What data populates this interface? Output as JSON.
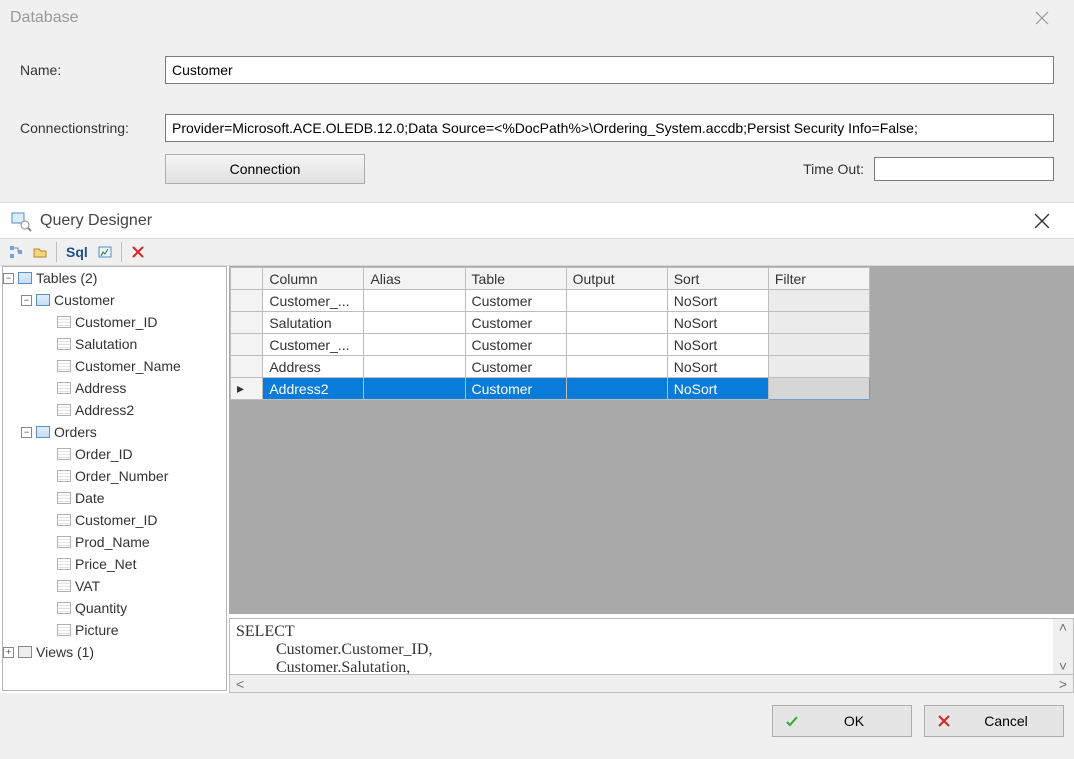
{
  "titlebar": {
    "title": "Database"
  },
  "form": {
    "name_label": "Name:",
    "name_value": "Customer",
    "conn_label": "Connectionstring:",
    "conn_value": "Provider=Microsoft.ACE.OLEDB.12.0;Data Source=<%DocPath%>\\Ordering_System.accdb;Persist Security Info=False;",
    "conn_button": "Connection",
    "timeout_label": "Time Out:",
    "timeout_value": ""
  },
  "qd": {
    "title": "Query Designer"
  },
  "toolbar": {
    "sql_label": "Sql"
  },
  "tree": {
    "root": "Tables (2)",
    "views": "Views (1)",
    "tables": [
      {
        "name": "Customer",
        "fields": [
          "Customer_ID",
          "Salutation",
          "Customer_Name",
          "Address",
          "Address2"
        ]
      },
      {
        "name": "Orders",
        "fields": [
          "Order_ID",
          "Order_Number",
          "Date",
          "Customer_ID",
          "Prod_Name",
          "Price_Net",
          "VAT",
          "Quantity",
          "Picture"
        ]
      }
    ]
  },
  "grid": {
    "headers": {
      "column": "Column",
      "alias": "Alias",
      "table": "Table",
      "output": "Output",
      "sort": "Sort",
      "filter": "Filter"
    },
    "rows": [
      {
        "column": "Customer_...",
        "alias": "",
        "table": "Customer",
        "output": "",
        "sort": "NoSort",
        "filter": "",
        "selected": false
      },
      {
        "column": "Salutation",
        "alias": "",
        "table": "Customer",
        "output": "",
        "sort": "NoSort",
        "filter": "",
        "selected": false
      },
      {
        "column": "Customer_...",
        "alias": "",
        "table": "Customer",
        "output": "",
        "sort": "NoSort",
        "filter": "",
        "selected": false
      },
      {
        "column": "Address",
        "alias": "",
        "table": "Customer",
        "output": "",
        "sort": "NoSort",
        "filter": "",
        "selected": false
      },
      {
        "column": "Address2",
        "alias": "",
        "table": "Customer",
        "output": "",
        "sort": "NoSort",
        "filter": "",
        "selected": true
      }
    ]
  },
  "sql": {
    "text": "SELECT\n          Customer.Customer_ID,\n          Customer.Salutation,"
  },
  "footer": {
    "ok": "OK",
    "cancel": "Cancel"
  }
}
